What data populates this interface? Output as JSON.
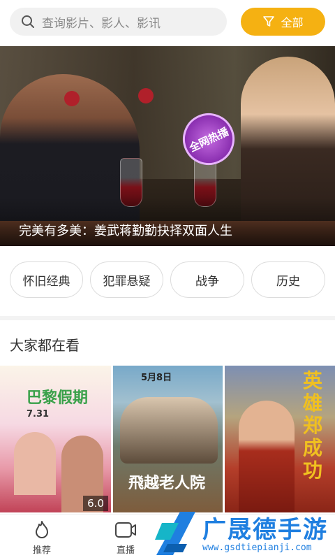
{
  "search": {
    "placeholder": "查询影片、影人、影讯",
    "icon": "search-icon"
  },
  "filter_button": {
    "label": "全部",
    "icon": "filter-icon",
    "color": "#f5b112"
  },
  "banner": {
    "caption": "完美有多美：姜武蒋勤勤抉择双面人生",
    "badge": "全网热播"
  },
  "tags": [
    "怀旧经典",
    "犯罪悬疑",
    "战争",
    "历史"
  ],
  "section": {
    "title": "大家都在看"
  },
  "posters": [
    {
      "title": "巴黎假期",
      "date": "7.31",
      "rating": "6.0"
    },
    {
      "title": "飛越老人院",
      "date": "5月8日"
    },
    {
      "title": "英雄郑成功"
    }
  ],
  "nav": [
    {
      "label": "推荐",
      "icon": "flame-icon"
    },
    {
      "label": "直播",
      "icon": "tv-icon"
    }
  ],
  "watermark": {
    "title": "广晟德手游",
    "url": "www.gsdtiepianji.com"
  }
}
